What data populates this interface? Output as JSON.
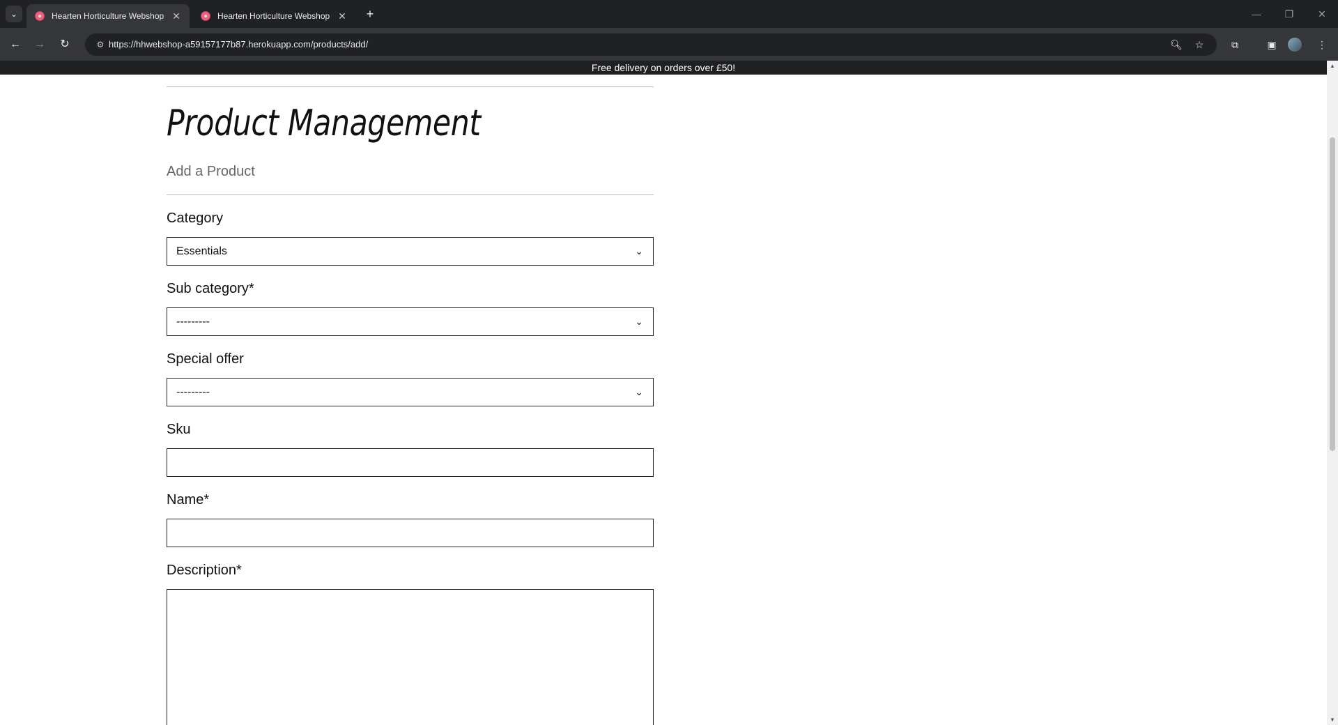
{
  "browser": {
    "tabs": [
      {
        "title": "Hearten Horticulture Webshop",
        "active": true
      },
      {
        "title": "Hearten Horticulture Webshop",
        "active": false
      }
    ],
    "url": "https://hhwebshop-a59157177b87.herokuapp.com/products/add/"
  },
  "banner": {
    "text": "Free delivery on orders over £50!"
  },
  "page": {
    "title": "Product Management",
    "subtitle": "Add a Product"
  },
  "form": {
    "category": {
      "label": "Category",
      "value": "Essentials"
    },
    "sub_category": {
      "label": "Sub category*",
      "value": "---------"
    },
    "special_offer": {
      "label": "Special offer",
      "value": "---------"
    },
    "sku": {
      "label": "Sku",
      "value": ""
    },
    "name": {
      "label": "Name*",
      "value": ""
    },
    "description": {
      "label": "Description*",
      "value": ""
    }
  },
  "icons": {
    "accent": "#e8657d",
    "chrome_dark": "#202124",
    "chrome_toolbar": "#35363a"
  }
}
